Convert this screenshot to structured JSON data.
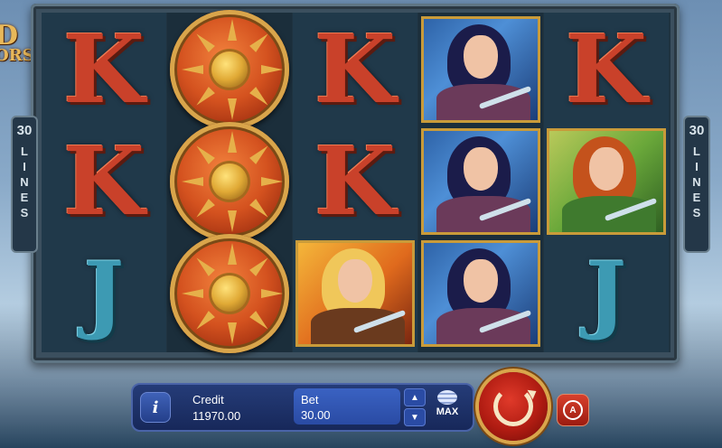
{
  "logo": {
    "line1": "D",
    "line2": "ORS"
  },
  "paylines": {
    "count": "30",
    "word": "LINES"
  },
  "reels": [
    [
      "K",
      "K",
      "J"
    ],
    [
      "shield",
      "shield",
      "shield"
    ],
    [
      "K",
      "K",
      "warrior-blonde"
    ],
    [
      "archer-dark",
      "archer-dark",
      "archer-dark"
    ],
    [
      "K",
      "archer-red",
      "J"
    ]
  ],
  "panel": {
    "info_icon": "i",
    "credit_label": "Credit",
    "credit_value": "11970.00",
    "bet_label": "Bet",
    "bet_value": "30.00",
    "max_label": "MAX"
  },
  "colors": {
    "panel": "#1e3168",
    "spin": "#b01c12",
    "gold": "#d9a54b"
  }
}
